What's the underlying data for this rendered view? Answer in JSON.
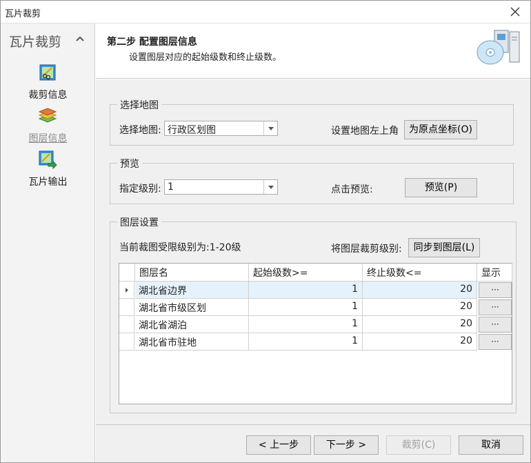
{
  "window": {
    "title": "瓦片裁剪"
  },
  "sidebar": {
    "title": "瓦片裁剪",
    "items": [
      {
        "label": "裁剪信息",
        "icon": "clip-icon",
        "active": false
      },
      {
        "label": "图层信息",
        "icon": "layers-icon",
        "active": true
      },
      {
        "label": "瓦片输出",
        "icon": "export-icon",
        "active": false
      }
    ]
  },
  "header": {
    "title": "第二步 配置图层信息",
    "subtitle": "设置图层对应的起始级数和终止级数。",
    "icon": "computer-disc-icon"
  },
  "map_group": {
    "legend": "选择地图",
    "select_label": "选择地图:",
    "select_value": "行政区划图",
    "origin_label": "设置地图左上角",
    "origin_button": "为原点坐标(O)"
  },
  "preview_group": {
    "legend": "预览",
    "level_label": "指定级别:",
    "level_value": "1",
    "click_label": "点击预览:",
    "preview_button": "预览(P)"
  },
  "layer_group": {
    "legend": "图层设置",
    "range_text": "当前裁图受限级别为:1-20级",
    "sync_label": "将图层裁剪级别:",
    "sync_button": "同步到图层(L)",
    "columns": [
      "图层名",
      "起始级数>=",
      "终止级数<=",
      "显示"
    ],
    "rows": [
      {
        "name": "湖北省边界",
        "start": "1",
        "end": "20",
        "show": "···"
      },
      {
        "name": "湖北省市级区划",
        "start": "1",
        "end": "20",
        "show": "···"
      },
      {
        "name": "湖北省湖泊",
        "start": "1",
        "end": "20",
        "show": "···"
      },
      {
        "name": "湖北省市驻地",
        "start": "1",
        "end": "20",
        "show": "···"
      }
    ]
  },
  "footer": {
    "prev": "< 上一步",
    "next": "下一步 >",
    "clip": "裁剪(C)",
    "cancel": "取消"
  }
}
